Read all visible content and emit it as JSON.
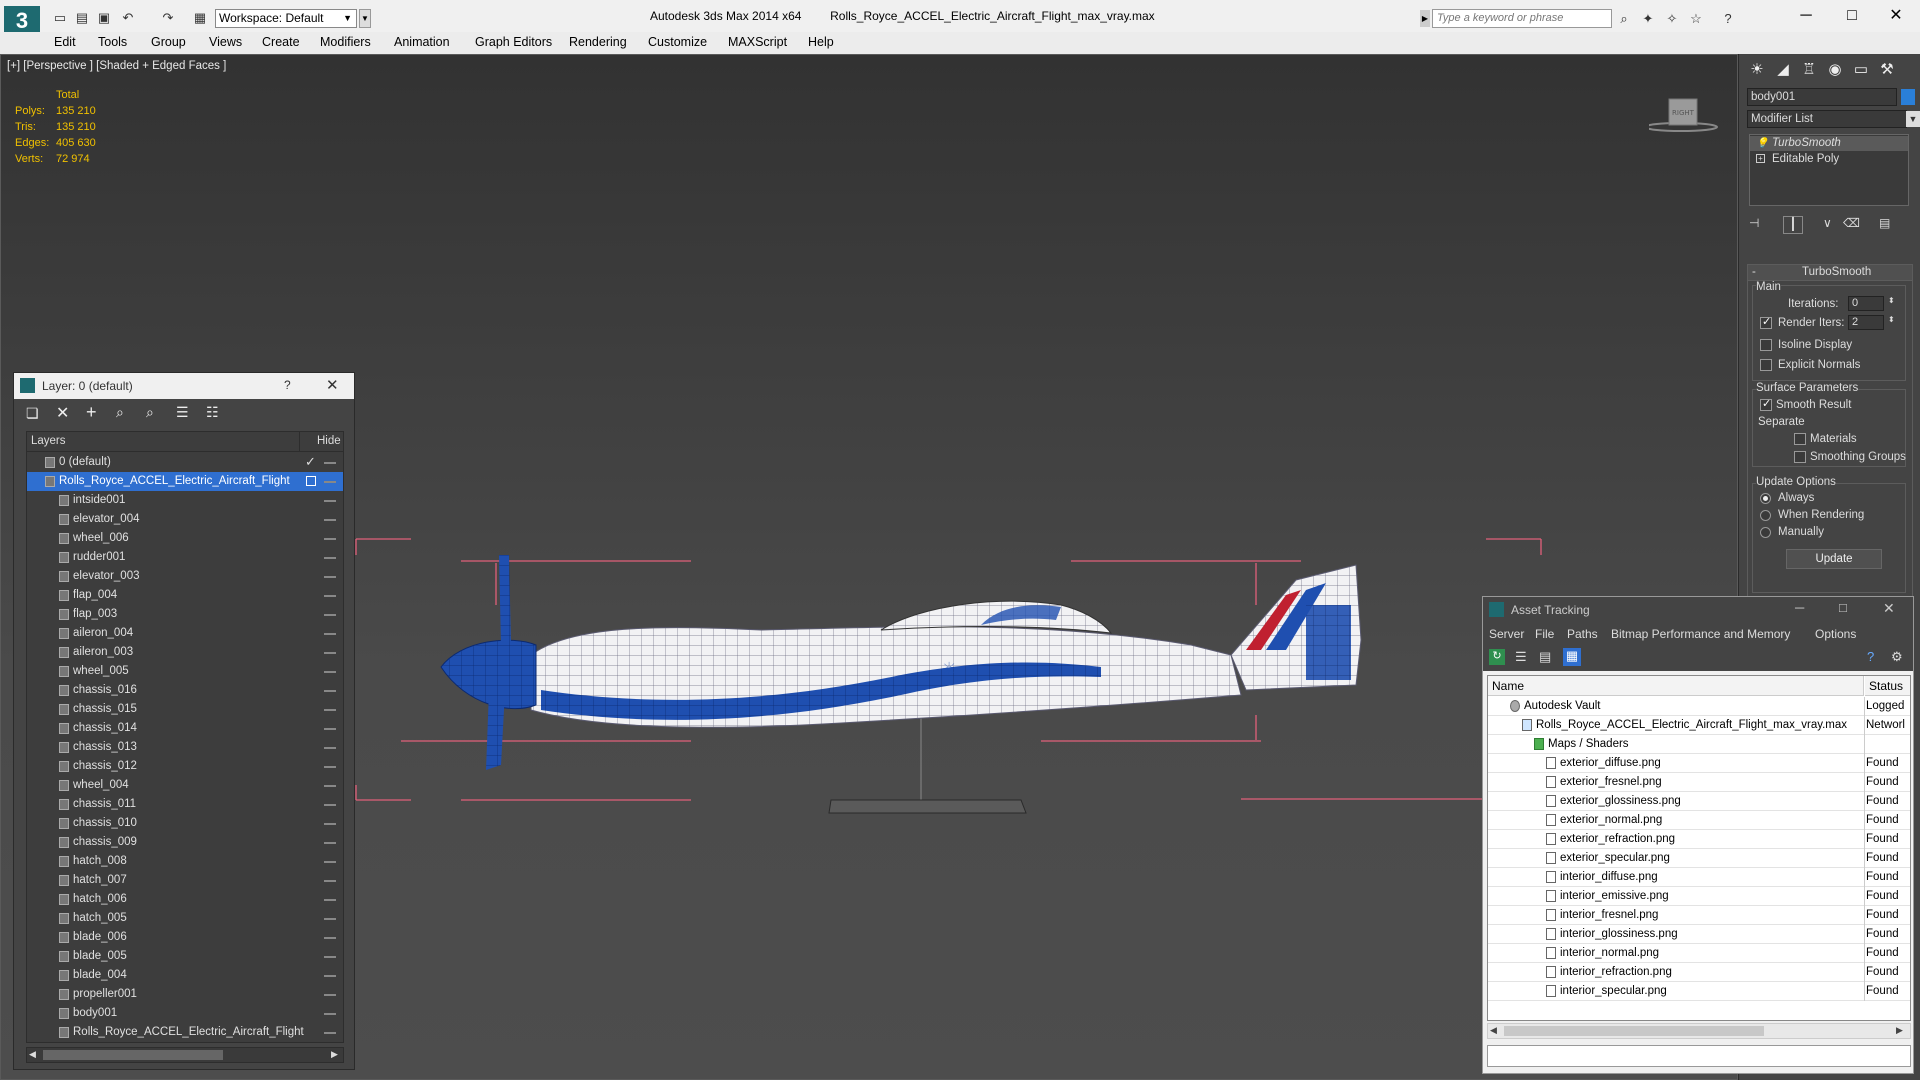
{
  "titlebar": {
    "workspace": "Workspace: Default",
    "app": "Autodesk 3ds Max  2014 x64",
    "file": "Rolls_Royce_ACCEL_Electric_Aircraft_Flight_max_vray.max",
    "search_placeholder": "Type a keyword or phrase"
  },
  "menu": [
    "Edit",
    "Tools",
    "Group",
    "Views",
    "Create",
    "Modifiers",
    "Animation",
    "Graph Editors",
    "Rendering",
    "Customize",
    "MAXScript",
    "Help"
  ],
  "viewport": {
    "label": "[+] [Perspective ] [Shaded + Edged Faces ]",
    "stats_header": "Total",
    "stats": [
      {
        "label": "Polys:",
        "value": "135 210"
      },
      {
        "label": "Tris:",
        "value": "135 210"
      },
      {
        "label": "Edges:",
        "value": "405 630"
      },
      {
        "label": "Verts:",
        "value": "72 974"
      }
    ],
    "viewcube_label": "RIGHT"
  },
  "layer_window": {
    "title": "Layer: 0 (default)",
    "help": "?",
    "col_layers": "Layers",
    "col_hide": "Hide",
    "rows": [
      {
        "name": "0 (default)",
        "level": 0
      },
      {
        "name": "Rolls_Royce_ACCEL_Electric_Aircraft_Flight",
        "level": 0
      },
      {
        "name": "intside001",
        "level": 1
      },
      {
        "name": "elevator_004",
        "level": 1
      },
      {
        "name": "wheel_006",
        "level": 1
      },
      {
        "name": "rudder001",
        "level": 1
      },
      {
        "name": "elevator_003",
        "level": 1
      },
      {
        "name": "flap_004",
        "level": 1
      },
      {
        "name": "flap_003",
        "level": 1
      },
      {
        "name": "aileron_004",
        "level": 1
      },
      {
        "name": "aileron_003",
        "level": 1
      },
      {
        "name": "wheel_005",
        "level": 1
      },
      {
        "name": "chassis_016",
        "level": 1
      },
      {
        "name": "chassis_015",
        "level": 1
      },
      {
        "name": "chassis_014",
        "level": 1
      },
      {
        "name": "chassis_013",
        "level": 1
      },
      {
        "name": "chassis_012",
        "level": 1
      },
      {
        "name": "wheel_004",
        "level": 1
      },
      {
        "name": "chassis_011",
        "level": 1
      },
      {
        "name": "chassis_010",
        "level": 1
      },
      {
        "name": "chassis_009",
        "level": 1
      },
      {
        "name": "hatch_008",
        "level": 1
      },
      {
        "name": "hatch_007",
        "level": 1
      },
      {
        "name": "hatch_006",
        "level": 1
      },
      {
        "name": "hatch_005",
        "level": 1
      },
      {
        "name": "blade_006",
        "level": 1
      },
      {
        "name": "blade_005",
        "level": 1
      },
      {
        "name": "blade_004",
        "level": 1
      },
      {
        "name": "propeller001",
        "level": 1
      },
      {
        "name": "body001",
        "level": 1
      },
      {
        "name": "Rolls_Royce_ACCEL_Electric_Aircraft_Flight",
        "level": 1
      }
    ]
  },
  "command_panel": {
    "object_name": "body001",
    "modifier_list": "Modifier List",
    "stack": [
      "TurboSmooth",
      "Editable Poly"
    ],
    "rollout_title": "TurboSmooth",
    "main_label": "Main",
    "iterations_label": "Iterations:",
    "iterations_value": "0",
    "render_iters_label": "Render Iters:",
    "render_iters_value": "2",
    "isoline_label": "Isoline Display",
    "explicit_normals_label": "Explicit Normals",
    "surface_params_label": "Surface Parameters",
    "smooth_result_label": "Smooth Result",
    "separate_label": "Separate",
    "materials_label": "Materials",
    "smoothing_groups_label": "Smoothing Groups",
    "update_options_label": "Update Options",
    "always_label": "Always",
    "when_rendering_label": "When Rendering",
    "manually_label": "Manually",
    "update_button": "Update"
  },
  "asset_tracking": {
    "title": "Asset Tracking",
    "menu": [
      "Server",
      "File",
      "Paths",
      "Bitmap Performance and Memory",
      "Options"
    ],
    "col_name": "Name",
    "col_status": "Status",
    "rows": [
      {
        "name": "Autodesk Vault",
        "status": "Logged",
        "level": 0
      },
      {
        "name": "Rolls_Royce_ACCEL_Electric_Aircraft_Flight_max_vray.max",
        "status": "Networl",
        "level": 1
      },
      {
        "name": "Maps / Shaders",
        "status": "",
        "level": 2
      },
      {
        "name": "exterior_diffuse.png",
        "status": "Found",
        "level": 3
      },
      {
        "name": "exterior_fresnel.png",
        "status": "Found",
        "level": 3
      },
      {
        "name": "exterior_glossiness.png",
        "status": "Found",
        "level": 3
      },
      {
        "name": "exterior_normal.png",
        "status": "Found",
        "level": 3
      },
      {
        "name": "exterior_refraction.png",
        "status": "Found",
        "level": 3
      },
      {
        "name": "exterior_specular.png",
        "status": "Found",
        "level": 3
      },
      {
        "name": "interior_diffuse.png",
        "status": "Found",
        "level": 3
      },
      {
        "name": "interior_emissive.png",
        "status": "Found",
        "level": 3
      },
      {
        "name": "interior_fresnel.png",
        "status": "Found",
        "level": 3
      },
      {
        "name": "interior_glossiness.png",
        "status": "Found",
        "level": 3
      },
      {
        "name": "interior_normal.png",
        "status": "Found",
        "level": 3
      },
      {
        "name": "interior_refraction.png",
        "status": "Found",
        "level": 3
      },
      {
        "name": "interior_specular.png",
        "status": "Found",
        "level": 3
      }
    ]
  },
  "colors": {
    "selection": "#2f6fd0",
    "stats_yellow": "#f0c000",
    "bbox_pink": "#e0607a",
    "aircraft_blue": "#1f4fb0",
    "aircraft_red": "#c02030"
  }
}
